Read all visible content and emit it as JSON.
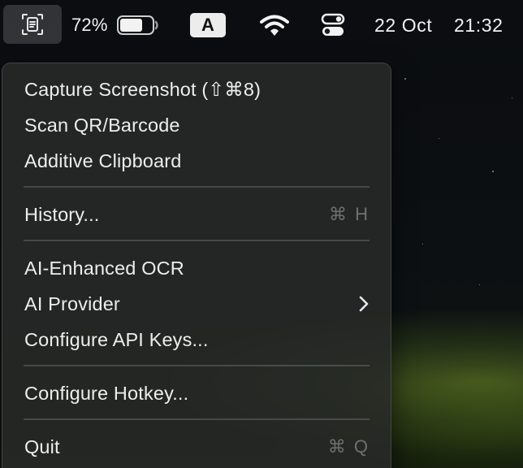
{
  "menubar": {
    "battery_percent": "72%",
    "battery_level": 0.72,
    "input_source": "A",
    "date": "22 Oct",
    "time": "21:32"
  },
  "menu": {
    "capture": {
      "label": "Capture Screenshot (⇧⌘8)"
    },
    "scan": {
      "label": "Scan QR/Barcode"
    },
    "additive": {
      "label": "Additive Clipboard"
    },
    "history": {
      "label": "History...",
      "shortcut": "⌘ H"
    },
    "ocr": {
      "label": "AI-Enhanced OCR"
    },
    "provider": {
      "label": "AI Provider",
      "icon": "chevron-right-icon"
    },
    "api_keys": {
      "label": "Configure API Keys..."
    },
    "hotkey": {
      "label": "Configure Hotkey..."
    },
    "quit": {
      "label": "Quit",
      "shortcut": "⌘ Q"
    }
  },
  "icons": {
    "app": "screenshot-app-icon",
    "battery": "battery-icon",
    "wifi": "wifi-icon",
    "control_center": "control-center-icon"
  },
  "colors": {
    "menu_bg": "#282a28",
    "menu_text": "#ededed",
    "shortcut_text": "#6f706e",
    "menubar_text": "#f2f2f2"
  }
}
